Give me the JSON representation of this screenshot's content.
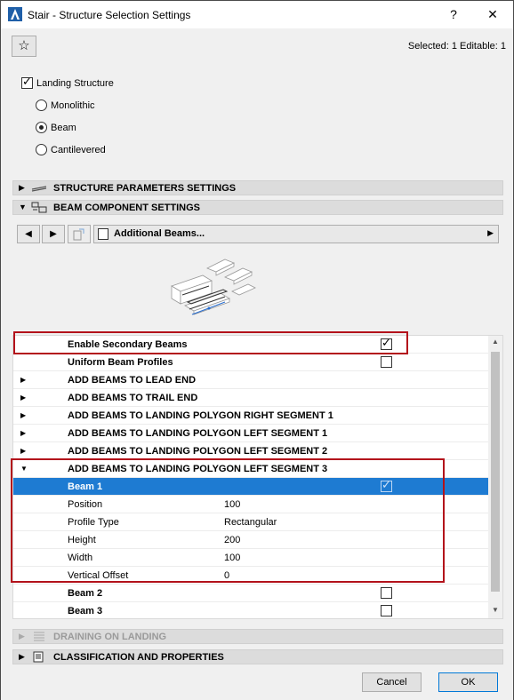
{
  "window": {
    "title": "Stair - Structure Selection Settings",
    "help_label": "?",
    "close_label": "✕"
  },
  "header": {
    "favorites_icon": "star-icon",
    "selected_info": "Selected: 1 Editable: 1"
  },
  "landing": {
    "checkbox_label": "Landing Structure",
    "checked": true,
    "options": [
      "Monolithic",
      "Beam",
      "Cantilevered"
    ],
    "selected": "Beam"
  },
  "sections": {
    "structure_params": "STRUCTURE PARAMETERS SETTINGS",
    "beam_component": "BEAM COMPONENT SETTINGS",
    "draining": "DRAINING ON LANDING",
    "classification": "CLASSIFICATION AND PROPERTIES"
  },
  "beam_toolbar": {
    "combo_label": "Additional Beams..."
  },
  "list": {
    "rows": [
      {
        "label": "Enable Secondary Beams",
        "bold": true,
        "checkbox": true,
        "checked": true
      },
      {
        "label": "Uniform Beam Profiles",
        "bold": true,
        "checkbox": true,
        "checked": false
      },
      {
        "label": "ADD BEAMS TO LEAD END",
        "bold": true,
        "group": true,
        "expanded": false
      },
      {
        "label": "ADD BEAMS TO TRAIL END",
        "bold": true,
        "group": true,
        "expanded": false
      },
      {
        "label": "ADD BEAMS TO LANDING POLYGON RIGHT SEGMENT 1",
        "bold": true,
        "group": true,
        "expanded": false
      },
      {
        "label": "ADD BEAMS TO LANDING POLYGON LEFT SEGMENT 1",
        "bold": true,
        "group": true,
        "expanded": false
      },
      {
        "label": "ADD BEAMS TO LANDING POLYGON LEFT SEGMENT 2",
        "bold": true,
        "group": true,
        "expanded": false
      },
      {
        "label": "ADD BEAMS TO LANDING POLYGON LEFT SEGMENT 3",
        "bold": true,
        "group": true,
        "expanded": true
      },
      {
        "label": "Beam 1",
        "bold": true,
        "checkbox": true,
        "checked": true,
        "selected": true
      },
      {
        "label": "Position",
        "value": "100"
      },
      {
        "label": "Profile Type",
        "value": "Rectangular"
      },
      {
        "label": "Height",
        "value": "200"
      },
      {
        "label": "Width",
        "value": "100"
      },
      {
        "label": "Vertical Offset",
        "value": "0"
      },
      {
        "label": "Beam 2",
        "bold": true,
        "checkbox": true,
        "checked": false
      },
      {
        "label": "Beam 3",
        "bold": true,
        "checkbox": true,
        "checked": false
      }
    ]
  },
  "buttons": {
    "cancel": "Cancel",
    "ok": "OK"
  },
  "colors": {
    "selection": "#1e7bd2",
    "highlight_box": "#b3121b"
  }
}
